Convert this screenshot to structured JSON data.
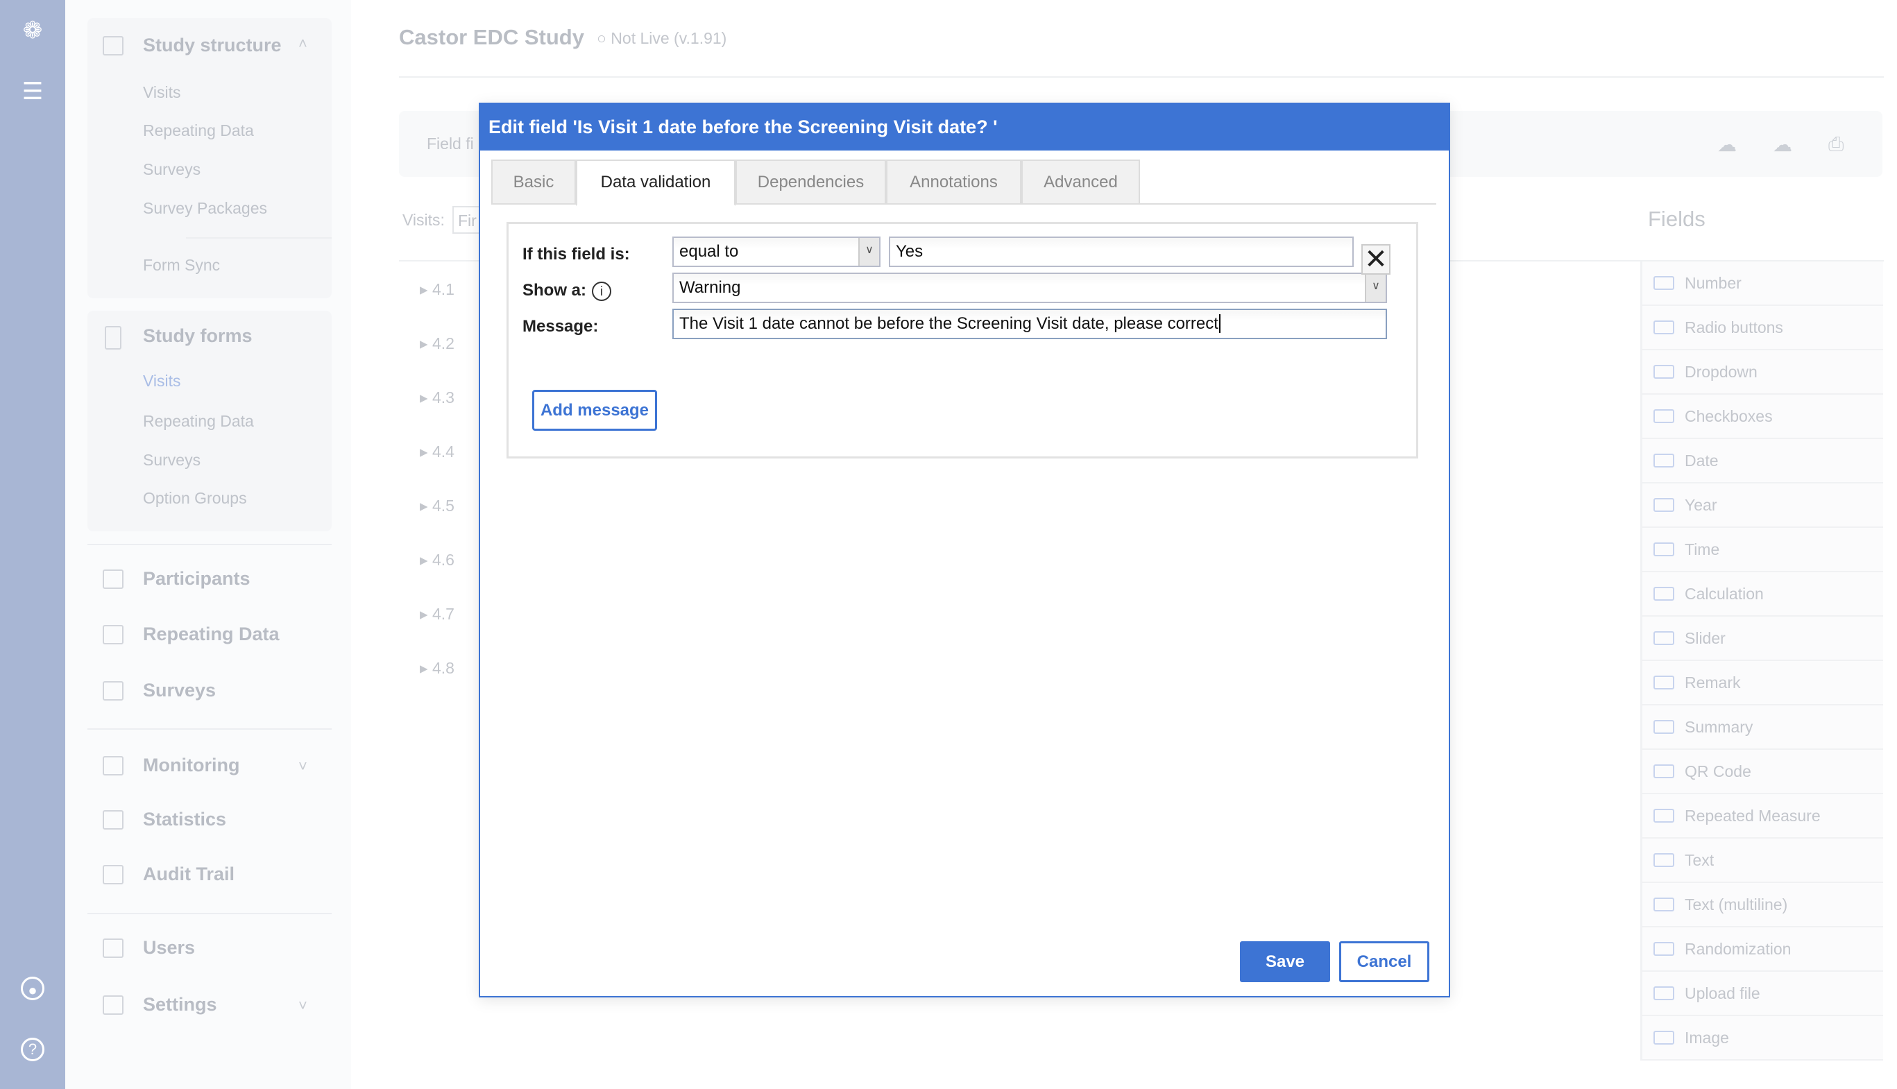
{
  "app": {
    "title": "Castor EDC Study",
    "status": "Not Live (v.1.91)"
  },
  "rail": {
    "icons": [
      "castor-logo-icon",
      "study-book-icon"
    ],
    "bottom": [
      "user-circle-icon",
      "help-icon"
    ]
  },
  "sidebar": {
    "study_structure": {
      "label": "Study structure",
      "items": [
        "Visits",
        "Repeating Data",
        "Surveys",
        "Survey Packages"
      ],
      "form_sync": "Form Sync"
    },
    "study_forms": {
      "label": "Study forms",
      "items": [
        "Visits",
        "Repeating Data",
        "Surveys",
        "Option Groups"
      ],
      "active": "Visits"
    },
    "main": [
      "Participants",
      "Repeating Data",
      "Surveys"
    ],
    "monitoring": [
      "Monitoring",
      "Statistics",
      "Audit Trail"
    ],
    "admin": [
      "Users",
      "Settings"
    ]
  },
  "toolbar": {
    "field_filter": "Field fi",
    "visits_label": "Visits:",
    "visits_value": "Fir"
  },
  "rows": [
    "4.1",
    "4.2",
    "4.3",
    "4.4",
    "4.5",
    "4.6",
    "4.7",
    "4.8"
  ],
  "fields_panel": {
    "title": "Fields",
    "items": [
      "Number",
      "Radio buttons",
      "Dropdown",
      "Checkboxes",
      "Date",
      "Year",
      "Time",
      "Calculation",
      "Slider",
      "Remark",
      "Summary",
      "QR Code",
      "Repeated Measure",
      "Text",
      "Text (multiline)",
      "Randomization",
      "Upload file",
      "Image"
    ]
  },
  "modal": {
    "title": "Edit field 'Is Visit 1 date before the Screening Visit date? '",
    "tabs": [
      "Basic",
      "Data validation",
      "Dependencies",
      "Annotations",
      "Advanced"
    ],
    "active_tab": "Data validation",
    "if_label": "If this field is:",
    "operator": "equal to",
    "value": "Yes",
    "show_label": "Show a:",
    "show_value": "Warning",
    "message_label": "Message:",
    "message_value": "The Visit 1 date cannot be before the Screening Visit date, please correct",
    "add_message": "Add message",
    "save": "Save",
    "cancel": "Cancel"
  },
  "colors": {
    "accent": "#3d74d4",
    "rail": "#a8b6d4"
  }
}
